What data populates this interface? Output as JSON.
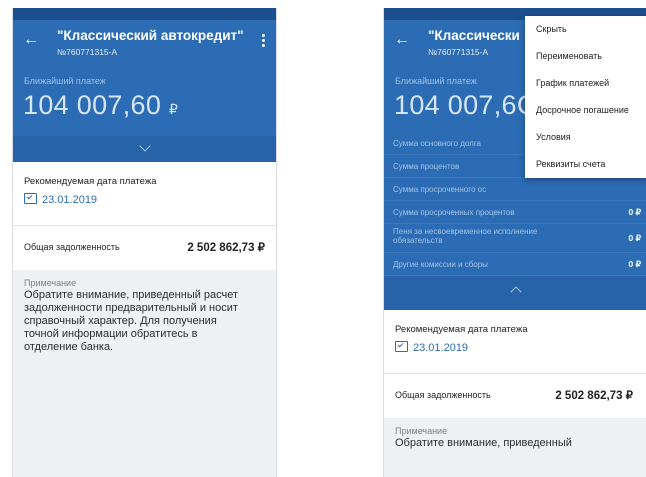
{
  "left": {
    "title": "\"Классический автокредит\"",
    "contract": "№760771315-А",
    "next_payment_label": "Ближайший платеж",
    "next_payment_amount": "104 007,60",
    "currency_sign": "₽",
    "recommended_date_label": "Рекомендуемая дата платежа",
    "recommended_date": "23.01.2019",
    "total_debt_label": "Общая задолженность",
    "total_debt_value": "2 502 862,73 ₽",
    "note_label": "Примечание",
    "note_text": "Обратите внимание, приведенный расчет задолженности предварительный и носит справочный характер. Для получения точной информации обратитесь в отделение банка."
  },
  "right": {
    "title": "\"Классически",
    "contract": "№760771315-А",
    "next_payment_label": "Ближайший платеж",
    "next_payment_amount": "104 007,6С",
    "breakdown": [
      {
        "label": "Сумма основного долга",
        "value": ""
      },
      {
        "label": "Сумма процентов",
        "value": ""
      },
      {
        "label": "Сумма просроченного ос",
        "value": ""
      },
      {
        "label": "Сумма просроченных процентов",
        "value": "0 ₽"
      },
      {
        "label": "Пеня за несвоевременное исполнение обязательств",
        "value": "0 ₽"
      },
      {
        "label": "Другие комиссии и сборы",
        "value": "0 ₽"
      }
    ],
    "recommended_date_label": "Рекомендуемая дата платежа",
    "recommended_date": "23.01.2019",
    "total_debt_label": "Общая задолженность",
    "total_debt_value": "2 502 862,73 ₽",
    "note_label": "Примечание",
    "note_text": "Обратите внимание, приведенный"
  },
  "menu": {
    "items": [
      "Скрыть",
      "Переименовать",
      "График платежей",
      "Досрочное погашение",
      "Условия",
      "Реквизиты счета"
    ]
  },
  "colors": {
    "brand": "#2c6cb4",
    "brand_dark": "#1d4f8f",
    "accent_text": "#2c6cb4"
  },
  "icons": {
    "back": "arrow-left-icon",
    "more": "kebab-menu-icon",
    "calendar": "calendar-check-icon",
    "expand": "chevron-down-icon",
    "collapse": "chevron-up-icon"
  }
}
